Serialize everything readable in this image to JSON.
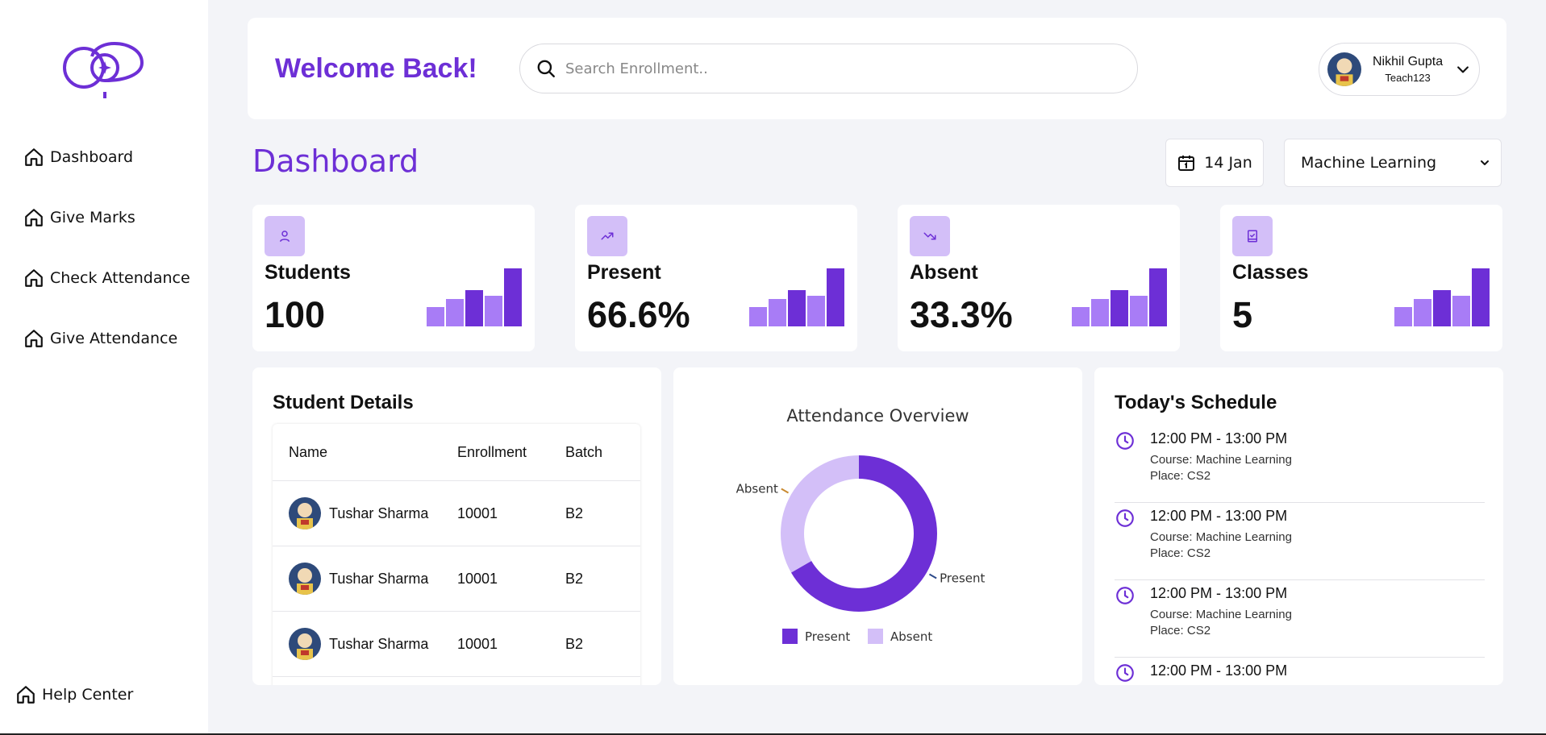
{
  "brand": {
    "logo_icon": "brand-logo-icon",
    "accent": "#6d2fd6",
    "accent_light": "#d3bff8"
  },
  "sidebar": {
    "items": [
      {
        "label": "Dashboard",
        "icon": "home-icon"
      },
      {
        "label": "Give Marks",
        "icon": "home-icon"
      },
      {
        "label": "Check Attendance",
        "icon": "home-icon"
      },
      {
        "label": "Give Attendance",
        "icon": "home-icon"
      }
    ],
    "help": {
      "label": "Help Center",
      "icon": "home-icon"
    }
  },
  "header": {
    "welcome": "Welcome Back!",
    "search_placeholder": "Search Enrollment..",
    "user": {
      "name": "Nikhil Gupta",
      "id": "Teach123"
    }
  },
  "dashboard": {
    "title": "Dashboard",
    "date": "14 Jan",
    "course": "Machine Learning"
  },
  "stats": [
    {
      "label": "Students",
      "value": "100",
      "icon": "user-icon"
    },
    {
      "label": "Present",
      "value": "66.6%",
      "icon": "trending-up-icon"
    },
    {
      "label": "Absent",
      "value": "33.3%",
      "icon": "trending-down-icon"
    },
    {
      "label": "Classes",
      "value": "5",
      "icon": "book-icon"
    }
  ],
  "student_details": {
    "title": "Student Details",
    "columns": [
      "Name",
      "Enrollment",
      "Batch"
    ],
    "rows": [
      {
        "name": "Tushar Sharma",
        "enrollment": "10001",
        "batch": "B2"
      },
      {
        "name": "Tushar Sharma",
        "enrollment": "10001",
        "batch": "B2"
      },
      {
        "name": "Tushar Sharma",
        "enrollment": "10001",
        "batch": "B2"
      }
    ]
  },
  "chart_data": {
    "type": "pie",
    "title": "Attendance Overview",
    "categories": [
      "Present",
      "Absent"
    ],
    "values": [
      66.6,
      33.3
    ],
    "colors": [
      "#6d2fd6",
      "#d3bff8"
    ],
    "legend": "bottom"
  },
  "schedule": {
    "title": "Today's Schedule",
    "items": [
      {
        "time": "12:00 PM - 13:00 PM",
        "course": "Course: Machine Learning",
        "place": "Place: CS2"
      },
      {
        "time": "12:00 PM - 13:00 PM",
        "course": "Course: Machine Learning",
        "place": "Place: CS2"
      },
      {
        "time": "12:00 PM - 13:00 PM",
        "course": "Course: Machine Learning",
        "place": "Place: CS2"
      },
      {
        "time": "12:00 PM - 13:00 PM"
      }
    ]
  }
}
